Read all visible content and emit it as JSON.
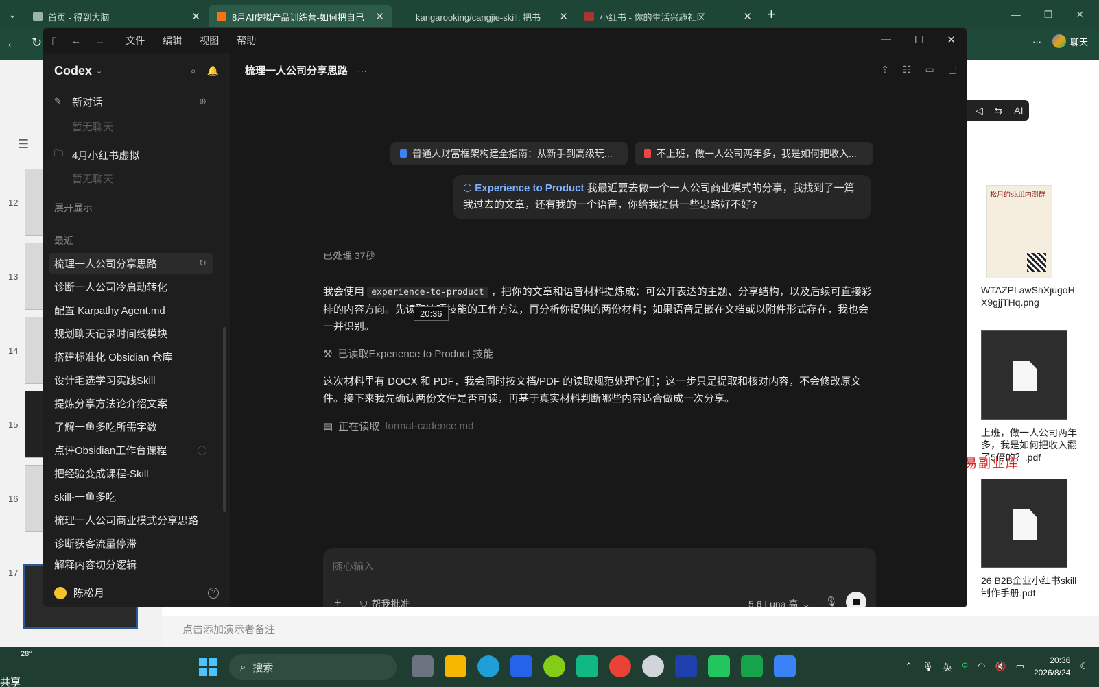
{
  "browser": {
    "tabs": [
      {
        "title": "首页 - 得到大脑",
        "active": false,
        "favicon_color": "#9db5a8"
      },
      {
        "title": "8月AI虚拟产品训练营-如何把自己",
        "active": true,
        "favicon_color": "#f97316"
      },
      {
        "title": "kangarooking/cangjie-skill: 把书",
        "active": false,
        "favicon_color": "#1e4636"
      },
      {
        "title": "小红书 - 你的生活兴趣社区",
        "active": false,
        "favicon_color": "#a33"
      }
    ],
    "chat_label": "聊天"
  },
  "app": {
    "menu": [
      "文件",
      "编辑",
      "视图",
      "帮助"
    ],
    "sidebar": {
      "brand": "Codex",
      "new_chat": "新对话",
      "no_chat_1": "暂无聊天",
      "project": "4月小红书虚拟",
      "no_chat_2": "暂无聊天",
      "expand": "展开显示",
      "recent_label": "最近",
      "recent": [
        "梳理一人公司分享思路",
        "诊断一人公司冷启动转化",
        "配置 Karpathy Agent.md",
        "规划聊天记录时间线模块",
        "搭建标准化 Obsidian 仓库",
        "设计毛选学习实践Skill",
        "提炼分享方法论介绍文案",
        "了解一鱼多吃所需字数",
        "点评Obsidian工作台课程",
        "把经验变成课程-Skill",
        "skill-一鱼多吃",
        "梳理一人公司商业模式分享思路",
        "诊断获客流量停滞",
        "解释内容切分逻辑"
      ],
      "user": "陈松月"
    },
    "conversation": {
      "title": "梳理一人公司分享思路",
      "attachments": [
        "普通人财富框架构建全指南：从新手到高级玩...",
        "不上班，做一人公司两年多，我是如何把收入..."
      ],
      "user_message_skill": "Experience to Product",
      "user_message": "我最近要去做一个一人公司商业模式的分享，我找到了一篇我过去的文章，还有我的一个语音，你给我提供一些思路好不好?",
      "processed": "已处理 37秒",
      "reply_1_before": "我会使用",
      "reply_1_code": "experience-to-product",
      "reply_1_after": "，把你的文章和语音材料提炼成：可公开表达的主题、分享结构，以及后续可直接彩排的内容方向。先读取这项技能的工作方法，再分析你提供的两份材料；如果语音是嵌在文档或以附件形式存在，我也会一并识别。",
      "tool_status": "已读取Experience to Product 技能",
      "reply_2": "这次材料里有 DOCX 和 PDF，我会同时按文档/PDF 的读取规范处理它们；这一步只是提取和核对内容，不会修改原文件。接下来我先确认两份文件是否可读，再基于真实材料判断哪些内容适合做成一次分享。",
      "reading_prefix": "正在读取",
      "reading_file": "format-cadence.md",
      "tooltip": "20:36"
    },
    "composer": {
      "placeholder": "随心输入",
      "approve": "帮我批准",
      "model": "5.6 Luna 高"
    }
  },
  "background": {
    "slide_numbers": [
      "12",
      "13",
      "14",
      "15",
      "16",
      "17"
    ],
    "notes_placeholder": "点击添加演示者备注",
    "file_1_title": "松月的skill内测群",
    "file_1_name": "WTAZPLawShXjugoHX9gjjTHq.png",
    "file_2_name": "上班，做一人公司两年多，我是如何把收入翻了5倍的？.pdf",
    "file_3_name": "26 B2B企业小红书skill制作手册.pdf",
    "watermark": "难事易副业库"
  },
  "taskbar": {
    "temperature": "28°",
    "share": "共享",
    "search": "搜索",
    "ime": "英",
    "time": "20:36",
    "date": "2026/8/24"
  }
}
